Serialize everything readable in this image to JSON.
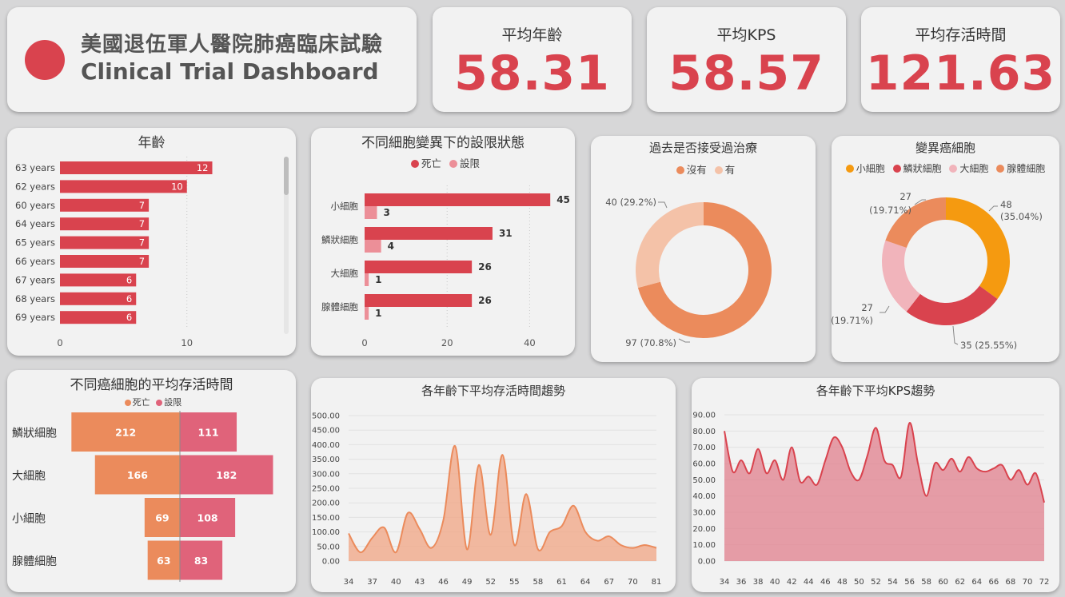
{
  "header": {
    "title_zh": "美國退伍軍人醫院肺癌臨床試驗",
    "title_en": "Clinical Trial Dashboard",
    "logo_color": "#d9434e"
  },
  "kpis": [
    {
      "label": "平均年齡",
      "value": "58.31"
    },
    {
      "label": "平均KPS",
      "value": "58.57"
    },
    {
      "label": "平均存活時間",
      "value": "121.63"
    }
  ],
  "colors": {
    "primary": "#d9434e",
    "pink": "#ec8f98",
    "orange": "#eb8b5c",
    "light_orange": "#f4c2a8",
    "amber": "#f59a10",
    "light_pink": "#f1b4bb",
    "dark_pink": "#e0637a"
  },
  "chart_data": [
    {
      "id": "age",
      "type": "bar",
      "title": "年齡",
      "categories": [
        "63 years",
        "62 years",
        "60 years",
        "64 years",
        "65 years",
        "66 years",
        "67 years",
        "68 years",
        "69 years"
      ],
      "values": [
        12,
        10,
        7,
        7,
        7,
        7,
        6,
        6,
        6
      ],
      "xticks": [
        "0",
        "10"
      ],
      "xlim": [
        0,
        16
      ]
    },
    {
      "id": "status",
      "type": "bar",
      "title": "不同細胞變異下的設限狀態",
      "categories": [
        "小細胞",
        "鱗狀細胞",
        "大細胞",
        "腺體細胞"
      ],
      "series": [
        {
          "name": "死亡",
          "values": [
            45,
            31,
            26,
            26
          ]
        },
        {
          "name": "設限",
          "values": [
            3,
            4,
            1,
            1
          ]
        }
      ],
      "xticks": [
        "0",
        "20",
        "40"
      ],
      "xlim": [
        0,
        50
      ]
    },
    {
      "id": "prior",
      "type": "pie",
      "title": "過去是否接受過治療",
      "legend": [
        "沒有",
        "有"
      ],
      "values": [
        97,
        40
      ],
      "labels": [
        "97 (70.8%)",
        "40 (29.2%)"
      ]
    },
    {
      "id": "celltype",
      "type": "pie",
      "title": "變異癌細胞",
      "legend": [
        "小細胞",
        "鱗狀細胞",
        "大細胞",
        "腺體細胞"
      ],
      "values": [
        48,
        35,
        27,
        27
      ],
      "labels": [
        [
          "48",
          "(35.04%)"
        ],
        [
          "35 (25.55%)"
        ],
        [
          "27",
          "(19.71%)"
        ],
        [
          "27",
          "(19.71%)"
        ]
      ]
    },
    {
      "id": "survival",
      "type": "bar",
      "title": "不同癌細胞的平均存活時間",
      "legend": [
        "死亡",
        "設限"
      ],
      "categories": [
        "鱗狀細胞",
        "大細胞",
        "小細胞",
        "腺體細胞"
      ],
      "series": [
        {
          "name": "死亡",
          "values": [
            212,
            166,
            69,
            63
          ]
        },
        {
          "name": "設限",
          "values": [
            111,
            182,
            108,
            83
          ]
        }
      ]
    },
    {
      "id": "survival_trend",
      "type": "area",
      "title": "各年齡下平均存活時間趨勢",
      "yticks": [
        "0.00",
        "50.00",
        "100.00",
        "150.00",
        "200.00",
        "250.00",
        "300.00",
        "350.00",
        "400.00",
        "450.00",
        "500.00"
      ],
      "xticks": [
        "34",
        "37",
        "40",
        "43",
        "46",
        "49",
        "52",
        "55",
        "58",
        "61",
        "64",
        "67",
        "70",
        "81"
      ],
      "ylim": [
        0,
        500
      ],
      "values": [
        95,
        30,
        80,
        115,
        30,
        165,
        110,
        45,
        140,
        395,
        40,
        330,
        90,
        365,
        55,
        230,
        40,
        100,
        120,
        190,
        100,
        70,
        85,
        55,
        45,
        55,
        45
      ]
    },
    {
      "id": "kps_trend",
      "type": "area",
      "title": "各年齡下平均KPS趨勢",
      "yticks": [
        "0.00",
        "10.00",
        "20.00",
        "30.00",
        "40.00",
        "50.00",
        "60.00",
        "70.00",
        "80.00",
        "90.00"
      ],
      "xticks": [
        "34",
        "36",
        "38",
        "40",
        "42",
        "44",
        "46",
        "48",
        "50",
        "52",
        "54",
        "56",
        "58",
        "60",
        "62",
        "64",
        "66",
        "68",
        "70",
        "72"
      ],
      "ylim": [
        0,
        90
      ],
      "values": [
        80,
        55,
        62,
        54,
        69,
        54,
        62,
        50,
        70,
        49,
        52,
        47,
        62,
        76,
        70,
        55,
        50,
        65,
        82,
        62,
        59,
        52,
        85,
        60,
        40,
        60,
        56,
        63,
        55,
        64,
        57,
        55,
        57,
        59,
        50,
        56,
        47,
        54,
        36
      ]
    }
  ]
}
